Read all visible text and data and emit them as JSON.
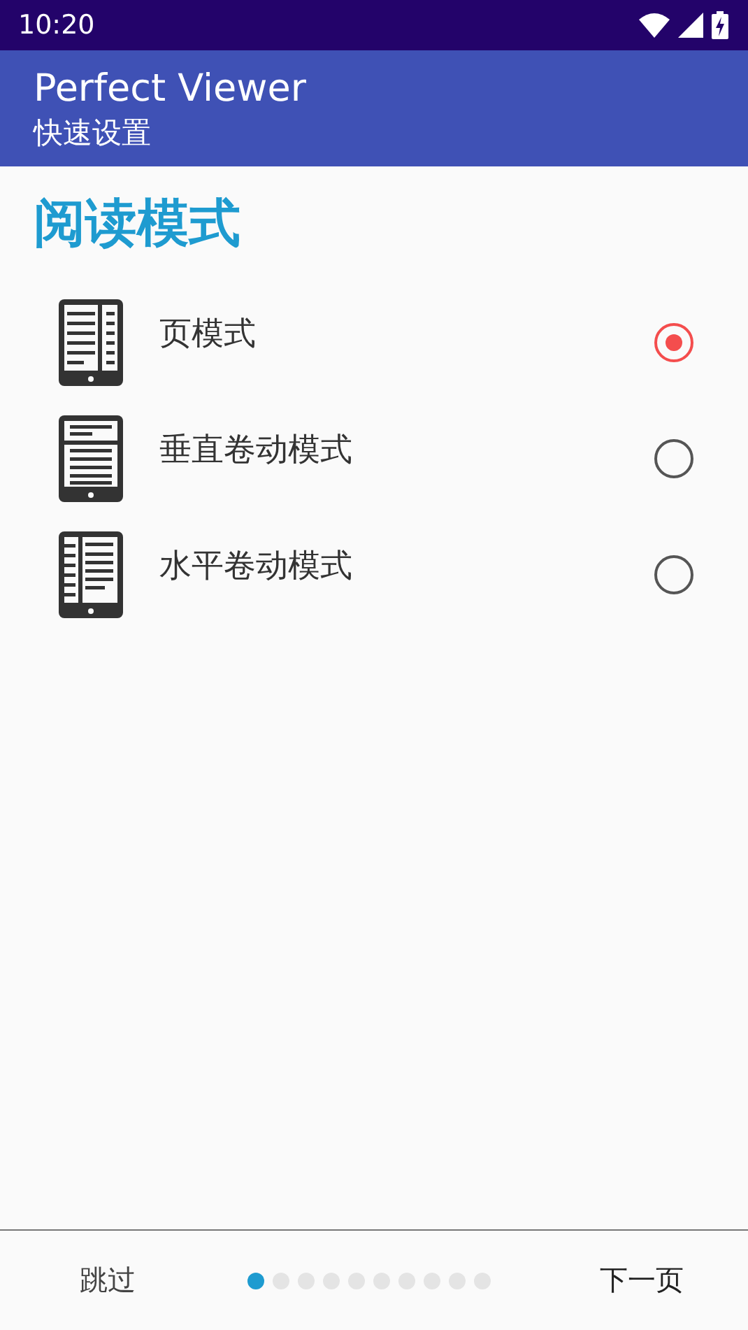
{
  "status_bar": {
    "time": "10:20"
  },
  "app_bar": {
    "title": "Perfect Viewer",
    "subtitle": "快速设置"
  },
  "section_title": "阅读模式",
  "options": [
    {
      "label": "页模式",
      "kind": "page",
      "selected": true
    },
    {
      "label": "垂直卷动模式",
      "kind": "vertical",
      "selected": false
    },
    {
      "label": "水平卷动模式",
      "kind": "horizontal",
      "selected": false
    }
  ],
  "footer": {
    "skip": "跳过",
    "next": "下一页",
    "pages": [
      {
        "selected": true
      },
      {
        "selected": false
      },
      {
        "selected": false
      },
      {
        "selected": false
      },
      {
        "selected": false
      },
      {
        "selected": false
      },
      {
        "selected": false
      },
      {
        "selected": false
      },
      {
        "selected": false
      },
      {
        "selected": false
      }
    ]
  }
}
